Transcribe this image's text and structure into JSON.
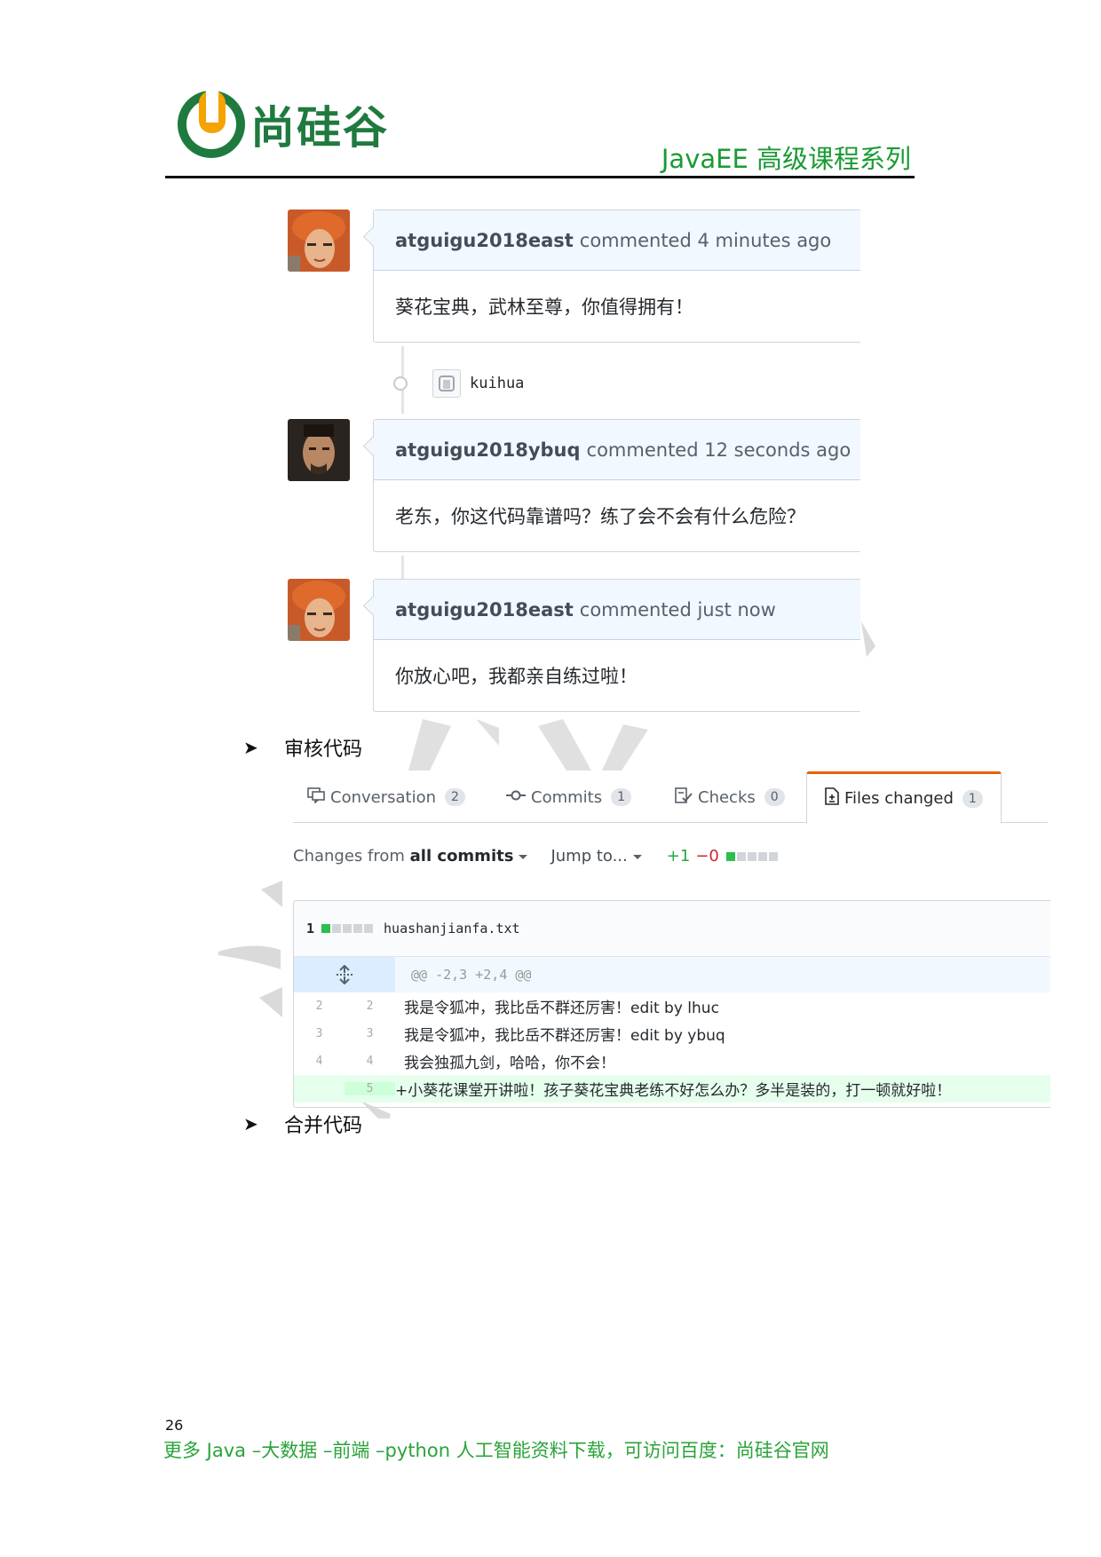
{
  "header": {
    "logo_text": "尚硅谷",
    "subtitle": "JavaEE 高级课程系列"
  },
  "timeline": {
    "comments": [
      {
        "author": "atguigu2018east",
        "meta": "commented 4 minutes ago",
        "body": "葵花宝典，武林至尊，你值得拥有！"
      },
      {
        "author": "atguigu2018ybuq",
        "meta": "commented 12 seconds ago",
        "body": "老东，你这代码靠谱吗？练了会不会有什么危险？"
      },
      {
        "author": "atguigu2018east",
        "meta": "commented just now",
        "body": "你放心吧，我都亲自练过啦！"
      }
    ],
    "event": {
      "label": "kuihua"
    }
  },
  "sections": {
    "review": "审核代码",
    "merge": "合并代码"
  },
  "tabs": [
    {
      "label": "Conversation",
      "count": "2",
      "icon": "comment-icon"
    },
    {
      "label": "Commits",
      "count": "1",
      "icon": "commit-icon"
    },
    {
      "label": "Checks",
      "count": "0",
      "icon": "checks-icon"
    },
    {
      "label": "Files changed",
      "count": "1",
      "icon": "file-diff-icon"
    }
  ],
  "toolbar": {
    "changes_prefix": "Changes from",
    "changes_strong": "all commits",
    "jump": "Jump to...",
    "additions": "+1",
    "deletions": "−0"
  },
  "diff": {
    "file_count": "1",
    "file_name": "huashanjianfa.txt",
    "hunk": "@@ -2,3 +2,4 @@",
    "lines": [
      {
        "old": "2",
        "new": "2",
        "text": "我是令狐冲，我比岳不群还厉害！edit by lhuc"
      },
      {
        "old": "3",
        "new": "3",
        "text": "我是令狐冲，我比岳不群还厉害！edit by ybuq"
      },
      {
        "old": "4",
        "new": "4",
        "text": "我会独孤九剑，哈哈，你不会！"
      },
      {
        "old": "",
        "new": "5",
        "text": "+小葵花课堂开讲啦！孩子葵花宝典老练不好怎么办？多半是装的，打一顿就好啦！"
      }
    ]
  },
  "footer": {
    "page_number": "26",
    "text": "更多 Java –大数据 –前端 –python 人工智能资料下载，可访问百度：尚硅谷官网"
  },
  "colors": {
    "brand_green": "#1f7a3e",
    "header_green": "#1a9a33",
    "footer_green": "#2aa33a",
    "addition_green": "#28a745",
    "tab_accent": "#e36209"
  }
}
